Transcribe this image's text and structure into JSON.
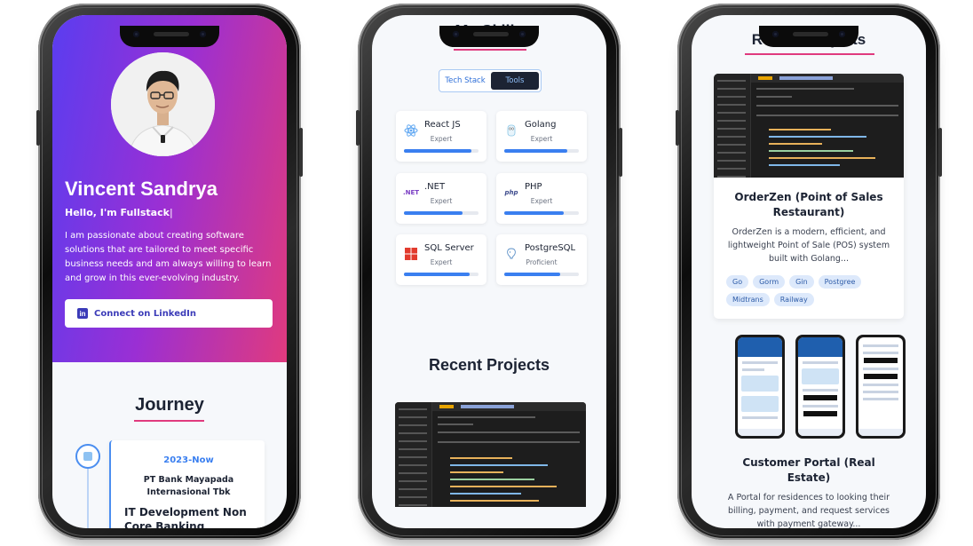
{
  "phone1": {
    "name": "Vincent Sandrya",
    "subtitle": "Hello, I'm Fullstack",
    "cursor": "|",
    "description": "I am passionate about creating software solutions that are tailored to meet specific business needs and am always willing to learn and grow in this ever-evolving industry.",
    "linkedin_label": "Connect on LinkedIn",
    "journey_title": "Journey",
    "job": {
      "period": "2023-Now",
      "company": "PT Bank Mayapada Internasional Tbk",
      "role": "IT Development Non Core Banking"
    }
  },
  "phone2": {
    "skills_title": "My Skills",
    "tabs": [
      {
        "label": "Tech Stack",
        "active": false
      },
      {
        "label": "Tools",
        "active": true
      }
    ],
    "skills": [
      {
        "name": "React JS",
        "level": "Expert",
        "progress": 0.9,
        "icon": "react-icon"
      },
      {
        "name": "Golang",
        "level": "Expert",
        "progress": 0.85,
        "icon": "golang-icon"
      },
      {
        "name": ".NET",
        "level": "Expert",
        "progress": 0.78,
        "icon": "dotnet-icon",
        "badge": ".NET"
      },
      {
        "name": "PHP",
        "level": "Expert",
        "progress": 0.8,
        "icon": "php-icon",
        "badge": "php"
      },
      {
        "name": "SQL Server",
        "level": "Expert",
        "progress": 0.88,
        "icon": "sqlserver-icon"
      },
      {
        "name": "PostgreSQL",
        "level": "Proficient",
        "progress": 0.75,
        "icon": "postgresql-icon"
      }
    ],
    "projects_title": "Recent Projects"
  },
  "phone3": {
    "projects_title": "Recent Projects",
    "projects": [
      {
        "title": "OrderZen (Point of Sales Restaurant)",
        "description": "OrderZen is a modern, efficient, and lightweight Point of Sale (POS) system built with Golang...",
        "tags": [
          "Go",
          "Gorm",
          "Gin",
          "Postgree",
          "Midtrans",
          "Railway"
        ]
      },
      {
        "title": "Customer Portal (Real Estate)",
        "description": "A Portal for residences to looking their billing, payment, and request services with payment gateway..."
      }
    ]
  },
  "colors": {
    "gradient_start": "#5a3df0",
    "gradient_end": "#e03a7e",
    "accent_blue": "#3a7ff0",
    "title_underline": "#e03a7e",
    "dark_text": "#1c2333"
  }
}
